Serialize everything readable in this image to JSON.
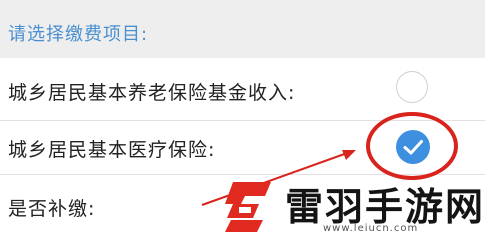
{
  "header": {
    "text": "请选择缴费项目:"
  },
  "rows": [
    {
      "label": "城乡居民基本养老保险基金收入:",
      "checked": false
    },
    {
      "label": "城乡居民基本医疗保险:",
      "checked": true
    },
    {
      "label": "是否补缴:"
    }
  ],
  "watermark": {
    "name": "雷羽手游网",
    "url": "www.leiucn.com"
  },
  "colors": {
    "accent": "#3d8fe0",
    "annotation": "#d9241d",
    "header_text": "#4a8fd0"
  },
  "icons": [
    "radio-unchecked-icon",
    "radio-checked-icon",
    "check-icon",
    "logo-icon"
  ]
}
